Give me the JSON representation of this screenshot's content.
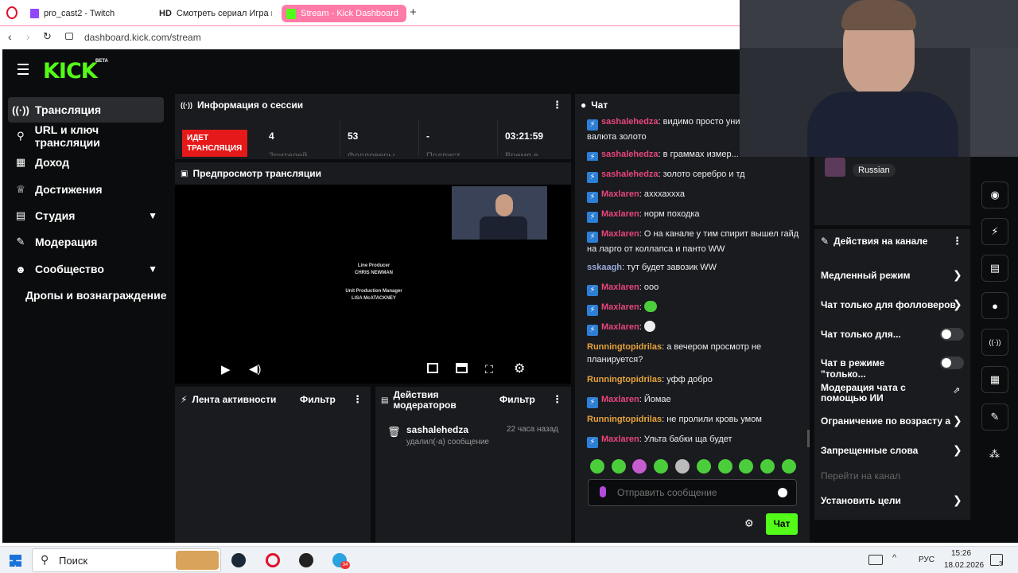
{
  "browser": {
    "tabs": [
      {
        "label": "pro_cast2 - Twitch"
      },
      {
        "label": "Смотреть сериал Игра п..."
      },
      {
        "label": "Stream - Kick Dashboard"
      }
    ],
    "hd_label": "HD",
    "url": "dashboard.kick.com/stream"
  },
  "brand": {
    "logo": "KICK",
    "beta": "BETA",
    "accent": "#53fc18"
  },
  "nav": [
    {
      "label": "Трансляция",
      "icon": "broadcast-icon"
    },
    {
      "label": "URL и ключ трансляции",
      "icon": "link-icon"
    },
    {
      "label": "Доход",
      "icon": "revenue-icon"
    },
    {
      "label": "Достижения",
      "icon": "trophy-icon"
    },
    {
      "label": "Студия",
      "icon": "studio-icon"
    },
    {
      "label": "Модерация",
      "icon": "wrench-icon"
    },
    {
      "label": "Сообщество",
      "icon": "community-icon"
    },
    {
      "label": "Дропы и вознаграждение"
    }
  ],
  "session": {
    "title": "Информация о сессии",
    "live_badge": "ИДЕТ ТРАНСЛЯЦИЯ",
    "stats": [
      {
        "value": "4",
        "label": "Зрителей"
      },
      {
        "value": "53",
        "label": "Фолловеры"
      },
      {
        "value": "-",
        "label": "Подпист..."
      },
      {
        "value": "03:21:59",
        "label": "Время в..."
      }
    ]
  },
  "preview": {
    "title": "Предпросмотр трансляции",
    "credits": [
      "Line Producer",
      "CHRIS NEWMAN",
      "Unit Production Manager",
      "LISA McATACKNEY"
    ]
  },
  "activity": {
    "title": "Лента активности",
    "filter": "Фильтр"
  },
  "modactions": {
    "title": "Действия модераторов",
    "filter": "Фильтр",
    "user": "sashalehedza",
    "time": "22 часа назад",
    "action": "удалил(-а) сообщение"
  },
  "chat": {
    "title": "Чат",
    "messages": [
      {
        "user": "sashalehedza",
        "text": "видимо просто универсальная валюта золото",
        "color": "pink",
        "badge": true
      },
      {
        "user": "sashalehedza",
        "text": "в граммах измер...",
        "color": "pink",
        "badge": true
      },
      {
        "user": "sashalehedza",
        "text": "золото серебро и тд",
        "color": "pink",
        "badge": true
      },
      {
        "user": "Maxlaren",
        "text": "ахххаххха",
        "color": "pink",
        "badge": true
      },
      {
        "user": "Maxlaren",
        "text": "норм походка",
        "color": "pink",
        "badge": true
      },
      {
        "user": "Maxlaren",
        "text": "О на канале у тим спирит вышел гайд на ларго от коллапса и панто WW",
        "color": "pink",
        "badge": true
      },
      {
        "user": "sskaagh",
        "text": "тут будет завозик WW",
        "color": "blue",
        "badge": false
      },
      {
        "user": "Maxlaren",
        "text": "ооо",
        "color": "pink",
        "badge": true
      },
      {
        "user": "Maxlaren",
        "text": "",
        "color": "pink",
        "badge": true
      },
      {
        "user": "Maxlaren",
        "text": "",
        "color": "pink",
        "badge": true
      },
      {
        "user": "Runningtopidrilas",
        "text": "а вечером просмотр не планируется?",
        "color": "orange",
        "badge": false
      },
      {
        "user": "Runningtopidrilas",
        "text": "уфф добро",
        "color": "orange",
        "badge": false
      },
      {
        "user": "Maxlaren",
        "text": "Йомае",
        "color": "pink",
        "badge": true
      },
      {
        "user": "Runningtopidrilas",
        "text": "не пролили кровь умом",
        "color": "orange",
        "badge": false
      },
      {
        "user": "Maxlaren",
        "text": "Ульта бабки ща будет",
        "color": "pink",
        "badge": true
      }
    ],
    "placeholder": "Отправить сообщение",
    "send": "Чат"
  },
  "channel": {
    "language": "Russian"
  },
  "channel_actions": {
    "title": "Действия на канале",
    "items": [
      {
        "label": "Медленный режим",
        "control": "arrow"
      },
      {
        "label": "Чат только для фолловеров",
        "control": "arrow"
      },
      {
        "label": "Чат только для...",
        "control": "toggle"
      },
      {
        "label": "Чат в режиме \"только...",
        "control": "toggle"
      },
      {
        "label": "Модерация чата с помощью ИИ",
        "control": "external"
      },
      {
        "label": "Ограничение по возрасту а",
        "control": "arrow"
      },
      {
        "label": "Запрещенные слова",
        "control": "arrow"
      },
      {
        "label": "Перейти на канал",
        "control": "none"
      },
      {
        "label": "Установить цели",
        "control": "arrow"
      }
    ]
  },
  "taskbar": {
    "search": "Поиск",
    "lang": "РУС",
    "time": "15:26",
    "date": "18.02.2026",
    "notif": "3",
    "telegram_badge": "34"
  }
}
